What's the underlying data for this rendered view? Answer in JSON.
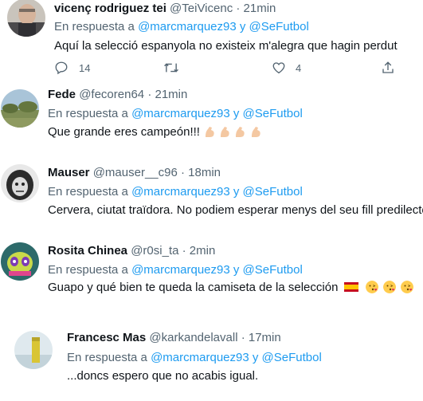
{
  "tweets": [
    {
      "name": "vicenç rodriguez tei",
      "handle": "@TeiVicenc",
      "sep": "·",
      "time": "21min",
      "reply_prefix": "En respuesta a",
      "mention1": "@marcmarquez93",
      "reply_and": "y",
      "mention2": "@SeFutbol",
      "text": "Aquí la selecció espanyola no existeix m'alegra que hagin perdut",
      "replies_count": "14",
      "likes_count": "4"
    },
    {
      "name": "Fede",
      "handle": "@fecoren64",
      "sep": "·",
      "time": "21min",
      "reply_prefix": "En respuesta a",
      "mention1": "@marcmarquez93",
      "reply_and": "y",
      "mention2": "@SeFutbol",
      "text": "Que grande eres campeón!!!"
    },
    {
      "name": "Mauser",
      "handle": "@mauser__c96",
      "sep": "·",
      "time": "18min",
      "reply_prefix": "En respuesta a",
      "mention1": "@marcmarquez93",
      "reply_and": "y",
      "mention2": "@SeFutbol",
      "text": "Cervera, ciutat traïdora. No podiem esperar menys del seu fill predilecte"
    },
    {
      "name": "Rosita Chinea",
      "handle": "@r0si_ta",
      "sep": "·",
      "time": "2min",
      "reply_prefix": "En respuesta a",
      "mention1": "@marcmarquez93",
      "reply_and": "y",
      "mention2": "@SeFutbol",
      "text": "Guapo y qué bien te queda la camiseta de la selección"
    },
    {
      "name": "Francesc Mas",
      "handle": "@karkandelavall",
      "sep": "·",
      "time": "17min",
      "reply_prefix": "En respuesta a",
      "mention1": "@marcmarquez93",
      "reply_and": "y",
      "mention2": "@SeFutbol",
      "text": "...doncs espero que no acabis igual."
    }
  ],
  "colors": {
    "link": "#1d9bf0",
    "muted": "#536471",
    "text": "#0f1419"
  },
  "icons": [
    "reply-icon",
    "retweet-icon",
    "like-icon",
    "share-icon",
    "flexed-biceps-emoji",
    "spain-flag-emoji",
    "kiss-emoji"
  ]
}
